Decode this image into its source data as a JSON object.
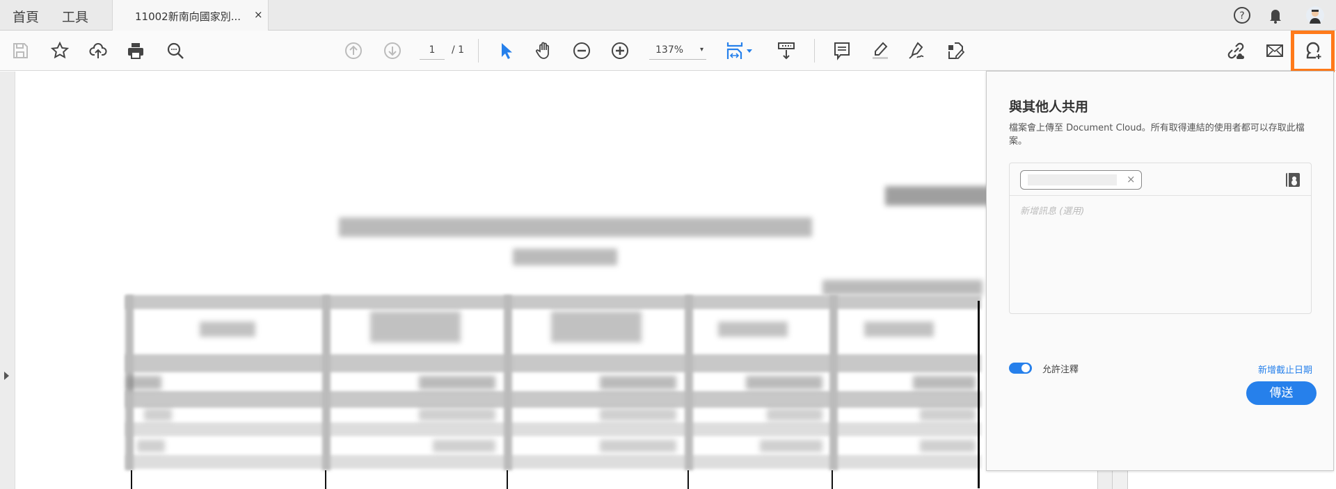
{
  "tabbar": {
    "home": "首頁",
    "tools": "工具",
    "doc_tab_title": "11002新南向國家別...",
    "close": "×"
  },
  "toolbar": {
    "page_current": "1",
    "page_total": "/ 1",
    "zoom": "137%",
    "zoom_arrow": "▾"
  },
  "share_panel": {
    "title": "與其他人共用",
    "description": "檔案會上傳至 Document Cloud。所有取得連結的使用者都可以存取此檔案。",
    "recipient_remove": "×",
    "message_placeholder": "新增訊息 (選用)",
    "allow_comments_label": "允許注釋",
    "allow_comments_on": true,
    "add_deadline_link": "新增截止日期",
    "send_button": "傳送"
  },
  "colors": {
    "accent": "#2680eb",
    "highlight": "#ff7a1a"
  }
}
